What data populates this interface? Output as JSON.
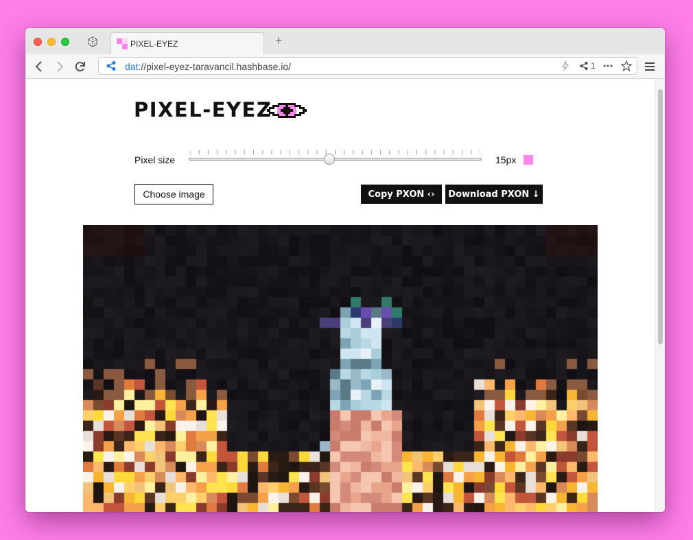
{
  "browser": {
    "tab_title": "PIXEL-EYEZ",
    "new_tab": "+",
    "url_protocol": "dat:",
    "url_rest": "//pixel-eyez-taravancil.hashbase.io/",
    "peer_count": "1"
  },
  "page": {
    "logo": "PIXEL-EYEZ",
    "pixel_size_label": "Pixel size",
    "pixel_size_value": "15px",
    "pixel_size": 15,
    "slider_fraction": 0.48,
    "swatch_color": "#ff86ea",
    "choose_image": "Choose image",
    "copy_pxon": "Copy PXON ‹›",
    "download_pxon": "Download PXON ↓"
  },
  "colors": {
    "background": "#ff7ee8",
    "accent": "#ff86ea",
    "button_dark": "#111111"
  },
  "icons": [
    "dice-icon",
    "favicon",
    "back-icon",
    "forward-icon",
    "reload-icon",
    "share-network-icon",
    "bolt-icon",
    "peers-icon",
    "more-icon",
    "bookmark-star-icon",
    "menu-icon",
    "eye-logo-icon"
  ]
}
